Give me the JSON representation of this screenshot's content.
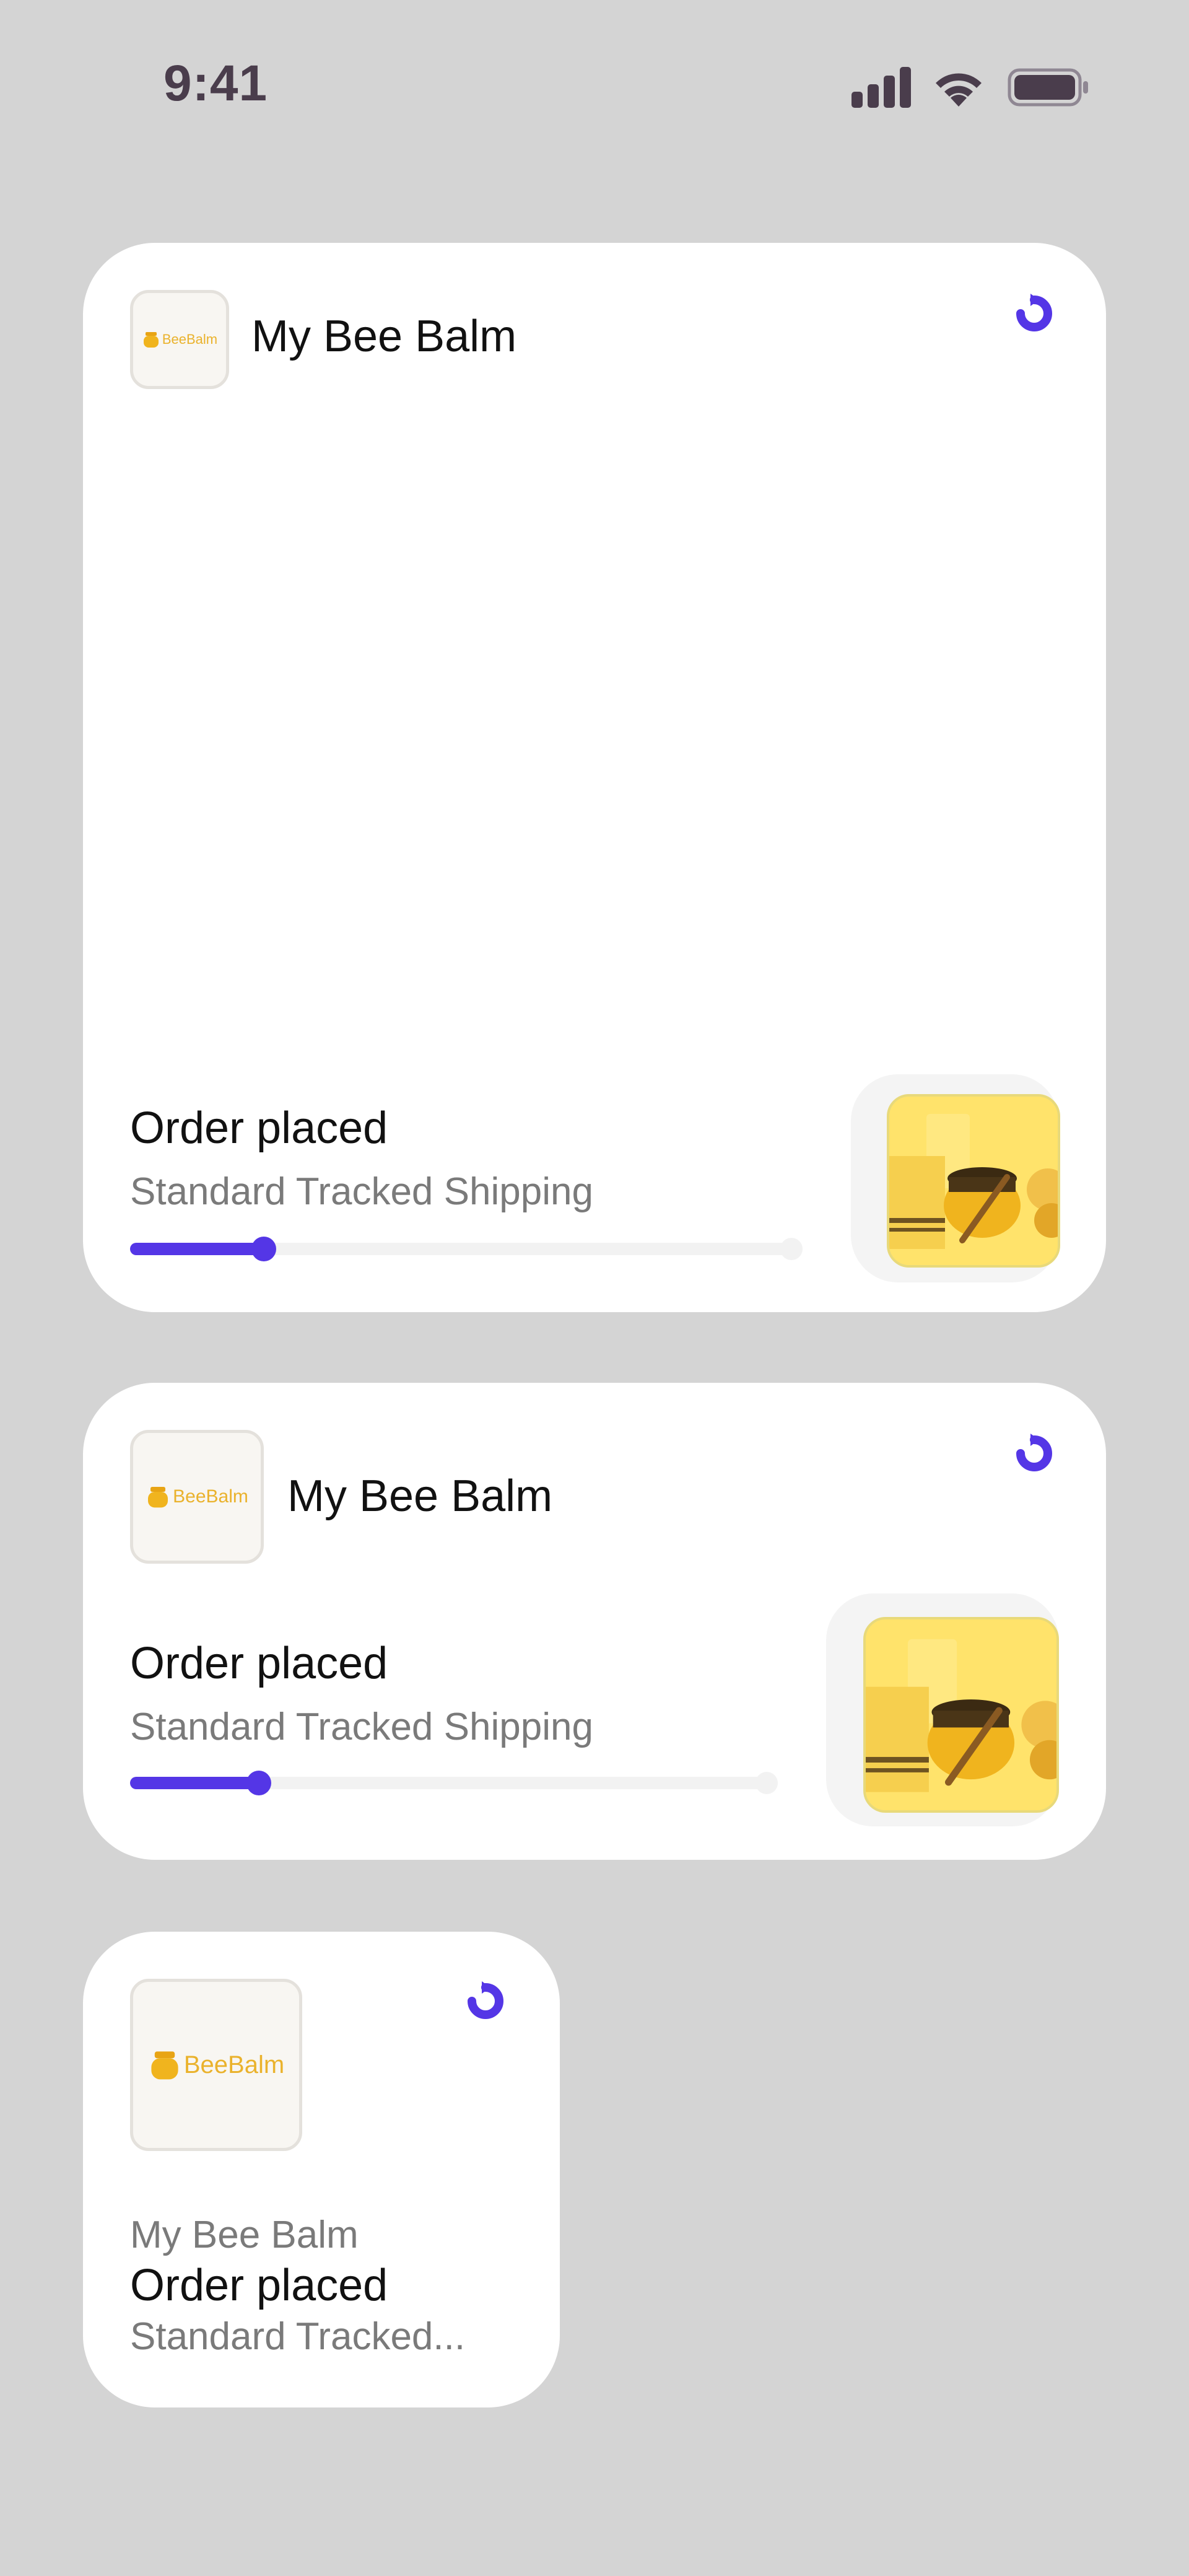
{
  "status_bar": {
    "time": "9:41"
  },
  "colors": {
    "accent": "#5436e6",
    "brand_gold": "#eab22c",
    "background": "#d4d4d4"
  },
  "widgets": {
    "large": {
      "brand": "My Bee Balm",
      "logo_text": "BeeBalm",
      "status": "Order placed",
      "shipping": "Standard Tracked Shipping",
      "progress": 0.2,
      "icon": "refresh-icon"
    },
    "medium": {
      "brand": "My Bee Balm",
      "logo_text": "BeeBalm",
      "status": "Order placed",
      "shipping": "Standard Tracked Shipping",
      "progress": 0.2,
      "icon": "refresh-icon"
    },
    "small": {
      "brand": "My Bee Balm",
      "logo_text": "BeeBalm",
      "status": "Order placed",
      "shipping": "Standard Tracked...",
      "icon": "refresh-icon"
    }
  }
}
